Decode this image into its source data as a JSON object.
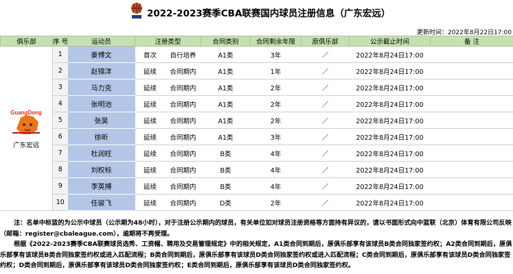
{
  "title": "2022-2023赛季CBA联赛国内球员注册信息（广东宏远）",
  "update_time": "更新时间：2022年8月22日17:00",
  "columns": [
    "俱乐部",
    "序 号",
    "运动员",
    "注册类型",
    "",
    "合同类别",
    "合同剩余年限",
    "原俱乐部",
    "公示截止时间",
    "备 注"
  ],
  "club": {
    "name": "广东宏远",
    "logo_text": "GuangDong"
  },
  "rows": [
    {
      "no": "1",
      "name": "姜博文",
      "reg1": "首次",
      "reg2": "自行培养",
      "cat": "A1类",
      "years": "3年",
      "orig": "／",
      "deadline": "2022年8月24日17:00",
      "note": ""
    },
    {
      "no": "2",
      "name": "赵锦洋",
      "reg1": "延续",
      "reg2": "合同期内",
      "cat": "A1类",
      "years": "1年",
      "orig": "／",
      "deadline": "2022年8月24日17:00",
      "note": ""
    },
    {
      "no": "3",
      "name": "马力克",
      "reg1": "延续",
      "reg2": "合同期内",
      "cat": "A1类",
      "years": "2年",
      "orig": "／",
      "deadline": "2022年8月24日17:00",
      "note": ""
    },
    {
      "no": "4",
      "name": "张明池",
      "reg1": "延续",
      "reg2": "合同期内",
      "cat": "A1类",
      "years": "2年",
      "orig": "／",
      "deadline": "2022年8月24日17:00",
      "note": ""
    },
    {
      "no": "5",
      "name": "张昊",
      "reg1": "延续",
      "reg2": "合同期内",
      "cat": "A1类",
      "years": "2年",
      "orig": "／",
      "deadline": "2022年8月24日17:00",
      "note": ""
    },
    {
      "no": "6",
      "name": "徐昕",
      "reg1": "延续",
      "reg2": "合同期内",
      "cat": "A1类",
      "years": "3年",
      "orig": "／",
      "deadline": "2022年8月24日17:00",
      "note": ""
    },
    {
      "no": "7",
      "name": "杜润旺",
      "reg1": "延续",
      "reg2": "合同期内",
      "cat": "B类",
      "years": "4年",
      "orig": "／",
      "deadline": "2022年8月24日17:00",
      "note": ""
    },
    {
      "no": "8",
      "name": "刘权标",
      "reg1": "延续",
      "reg2": "合同期内",
      "cat": "B类",
      "years": "4年",
      "orig": "／",
      "deadline": "2022年8月24日17:00",
      "note": ""
    },
    {
      "no": "9",
      "name": "李英搏",
      "reg1": "延续",
      "reg2": "合同期内",
      "cat": "B类",
      "years": "4年",
      "orig": "／",
      "deadline": "2022年8月24日17:00",
      "note": ""
    },
    {
      "no": "10",
      "name": "任骏飞",
      "reg1": "延续",
      "reg2": "合同期内",
      "cat": "D类",
      "years": "2年",
      "orig": "／",
      "deadline": "2022年8月24日17:00",
      "note": ""
    }
  ],
  "notes": [
    "注：名单中标蓝的为公示中球员（公示期为48小时），对于注册公示期内的球员，有关单位如对球员注册资格等方面持有异议的，请以书面形式向中篮联（北京）体育有限公司反映（邮箱：register@cbaleague.com），逾期将不再受理。",
    "根据《2022-2023赛季CBA联赛球员选秀、工资帽、聘用及交易管理规定》中的相关规定，A1类合同到期后，原俱乐部享有该球员B类合同独家签约权；A2类合同到期后，原俱乐部享有该球员B类合同独家签约权或进入匹配流程；B类合同到期后，原俱乐部享有该球员D类合同独家签约权或进入匹配流程；C类合同到期后，原俱乐部享有该球员D类合同独家签约权；D类合同到期后，原俱乐部享有该球员D类合同独家签约权；E类合同到期后，原俱乐部享有该球员D类合同独家签约权。"
  ],
  "colors": {
    "header_green": "#c6e0b4",
    "name_blue": "#b4c6e7",
    "logo_orange": "#e8761a"
  }
}
